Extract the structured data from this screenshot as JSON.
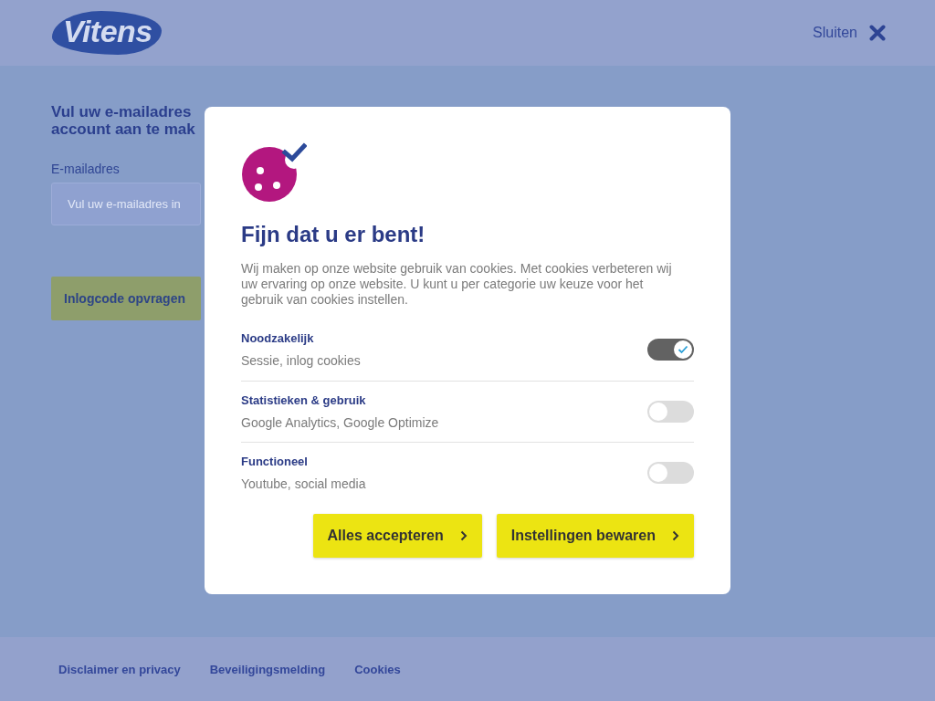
{
  "header": {
    "logo": "Vitens",
    "close_label": "Sluiten"
  },
  "login_form": {
    "heading_lines": [
      "Vul uw e-mailadres",
      "account aan te mak"
    ],
    "email_field": {
      "label": "E-mailadres",
      "placeholder": "Vul uw e-mailadres in"
    },
    "submit_button": "Inlogcode opvragen"
  },
  "cookie_dialog": {
    "title": "Fijn dat u er bent!",
    "intro": "Wij maken op onze website gebruik van cookies. Met cookies verbeteren wij uw ervaring op onze website. U kunt u per categorie uw keuze voor het gebruik van cookies instellen.",
    "categories": [
      {
        "name": "Noodzakelijk",
        "description": "Sessie, inlog cookies",
        "on": true
      },
      {
        "name": "Statistieken & gebruik",
        "description": "Google Analytics, Google Optimize",
        "on": false
      },
      {
        "name": "Functioneel",
        "description": "Youtube, social media",
        "on": false
      }
    ],
    "buttons": [
      "Alles accepteren",
      "Instellingen bewaren"
    ]
  },
  "footer": {
    "links": [
      "Disclaimer en privacy",
      "Beveiligingsmelding",
      "Cookies"
    ]
  }
}
